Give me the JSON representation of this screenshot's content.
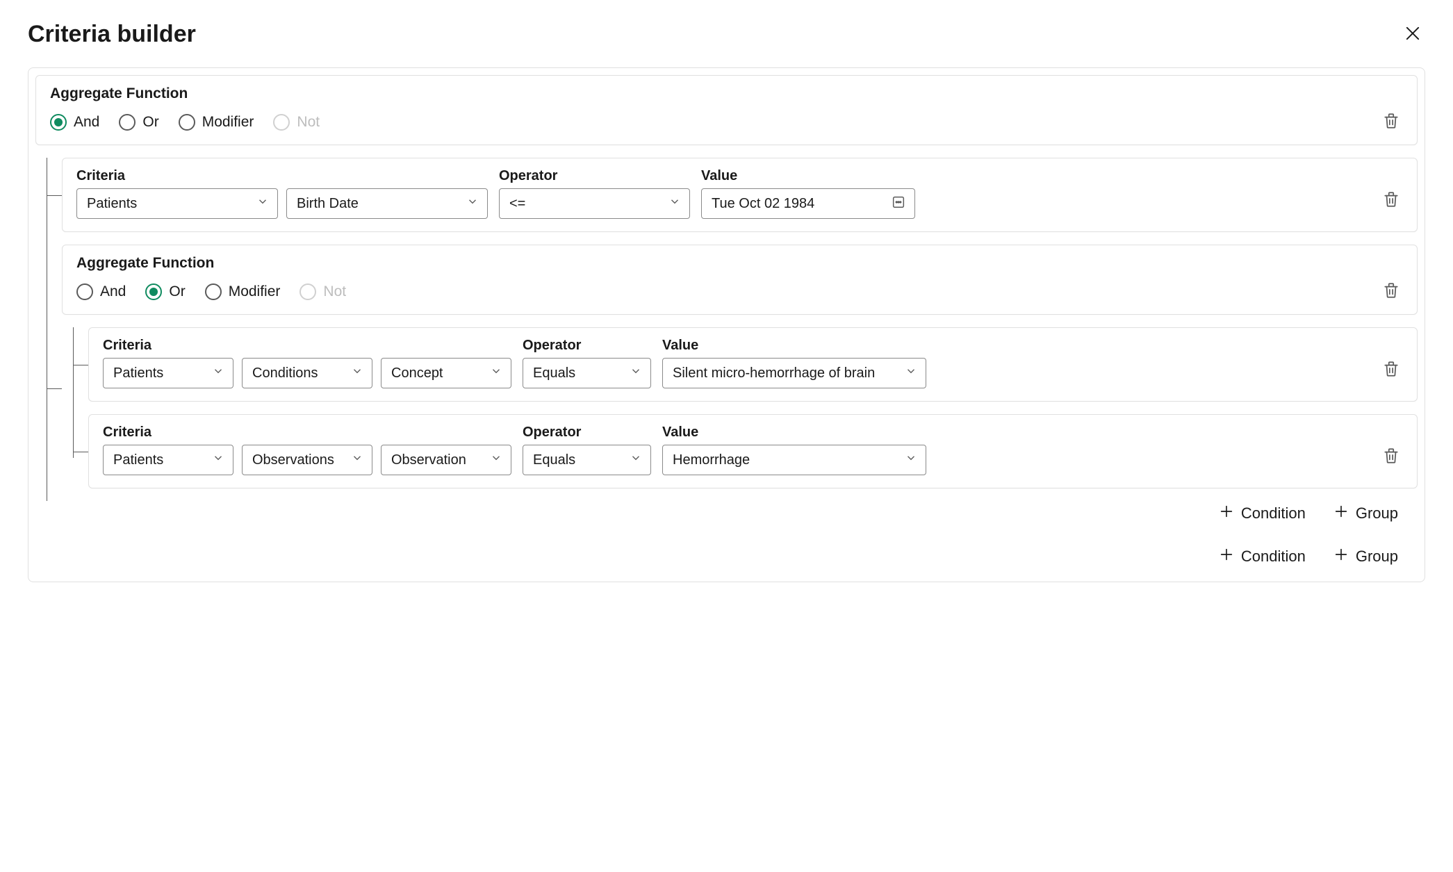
{
  "header": {
    "title": "Criteria builder"
  },
  "labels": {
    "aggregate_function": "Aggregate Function",
    "criteria": "Criteria",
    "operator": "Operator",
    "value": "Value",
    "add_condition": "Condition",
    "add_group": "Group"
  },
  "radio_options": {
    "and": "And",
    "or": "Or",
    "modifier": "Modifier",
    "not": "Not"
  },
  "root_group": {
    "selected": "and",
    "children": [
      {
        "type": "condition",
        "criteria": [
          "Patients",
          "Birth Date"
        ],
        "operator": "<=",
        "value": "Tue Oct 02 1984",
        "value_kind": "date"
      },
      {
        "type": "group",
        "selected": "or",
        "children": [
          {
            "type": "condition",
            "criteria": [
              "Patients",
              "Conditions",
              "Concept"
            ],
            "operator": "Equals",
            "value": "Silent micro-hemorrhage of brain",
            "value_kind": "select"
          },
          {
            "type": "condition",
            "criteria": [
              "Patients",
              "Observations",
              "Observation"
            ],
            "operator": "Equals",
            "value": "Hemorrhage",
            "value_kind": "select"
          }
        ]
      }
    ]
  }
}
